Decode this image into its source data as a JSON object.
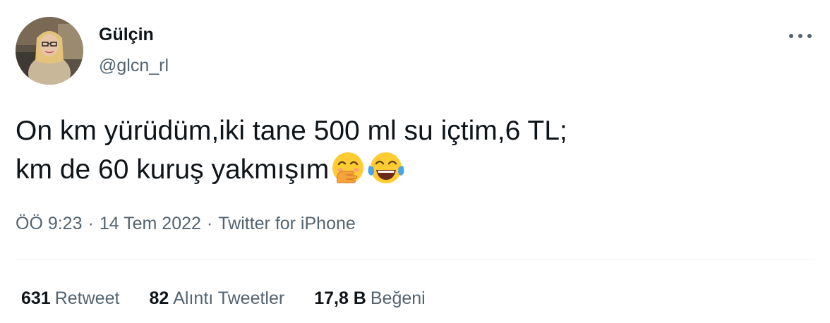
{
  "user": {
    "display_name": "Gülçin",
    "handle": "@glcn_rl"
  },
  "tweet": {
    "line1": "On km yürüdüm,iki tane 500 ml su içtim,6 TL;",
    "line2": "km de 60 kuruş yakmışım",
    "emojis": [
      "face-with-hand-over-mouth-icon",
      "face-with-tears-of-joy-icon"
    ]
  },
  "meta": {
    "time": "ÖÖ 9:23",
    "separator": "·",
    "date": "14 Tem 2022",
    "source": "Twitter for iPhone"
  },
  "stats": {
    "retweets_count": "631",
    "retweets_label": "Retweet",
    "quotes_count": "82",
    "quotes_label": "Alıntı Tweetler",
    "likes_count": "17,8 B",
    "likes_label": "Beğeni"
  },
  "colors": {
    "text_primary": "#0f1419",
    "text_secondary": "#536471",
    "divider": "#eff3f4"
  }
}
